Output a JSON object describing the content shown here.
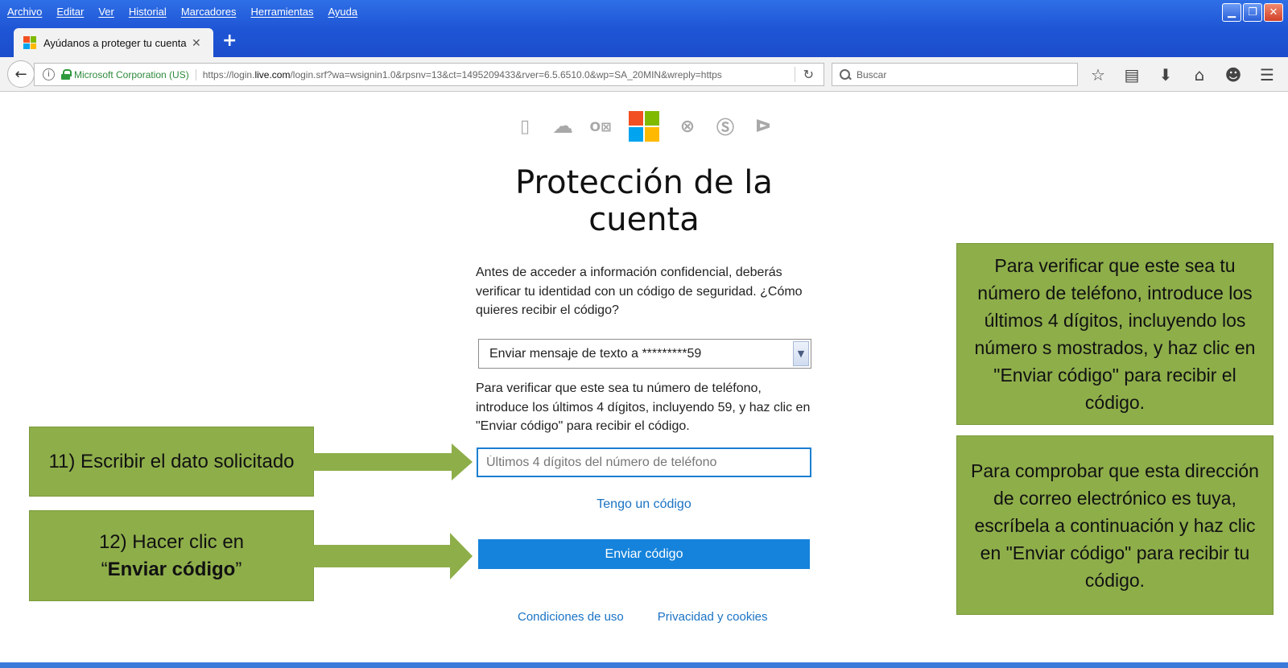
{
  "menubar": {
    "items": [
      "Archivo",
      "Editar",
      "Ver",
      "Historial",
      "Marcadores",
      "Herramientas",
      "Ayuda"
    ]
  },
  "tab": {
    "title": "Ayúdanos a proteger tu cuenta",
    "close": "✕"
  },
  "newtab": "+",
  "urlbar": {
    "identity": "Microsoft Corporation (US)",
    "url_prefix": "https://login.",
    "url_host": "live.com",
    "url_rest": "/login.srf?wa=wsignin1.0&rpsnv=13&ct=1495209433&rver=6.5.6510.0&wp=SA_20MIN&wreply=https"
  },
  "searchbar": {
    "placeholder": "Buscar"
  },
  "page": {
    "heading": "Protección de la cuenta",
    "intro": "Antes de acceder a información confidencial, deberás verificar tu identidad con un código de seguridad. ¿Cómo quieres recibir el código?",
    "select_value": "Enviar mensaje de texto a *********59",
    "verify_text": "Para verificar que este sea tu número de teléfono, introduce los últimos 4 dígitos, incluyendo 59, y haz clic en \"Enviar código\" para recibir el código.",
    "phone_placeholder": "Últimos 4 dígitos del número de teléfono",
    "have_code": "Tengo un código",
    "send_button": "Enviar código",
    "footer": {
      "terms": "Condiciones de uso",
      "privacy": "Privacidad y cookies"
    }
  },
  "annotations": {
    "step11": "11) Escribir el dato solicitado",
    "step12_line1": "12) Hacer clic en",
    "step12_quote_open": "“",
    "step12_bold": "Enviar código",
    "step12_quote_close": "”",
    "right_top": "Para verificar que este sea tu número de teléfono, introduce los últimos 4 dígitos, incluyendo los número s mostrados, y haz clic en \"Enviar código\" para recibir el código.",
    "right_bottom": "Para comprobar que esta dirección de correo electrónico es tuya, escríbela a continuación y haz clic en \"Enviar código\" para recibir tu código."
  },
  "colors": {
    "accent": "#1583db",
    "link": "#1a73c4",
    "callout_green": "#8eae4a",
    "titlebar_blue": "#1f56d6"
  },
  "icons": {
    "products": [
      "office-icon",
      "onedrive-icon",
      "outlook-icon",
      "microsoft-logo",
      "xbox-icon",
      "skype-icon",
      "bing-icon"
    ],
    "toolbar": [
      "bookmark-star-icon",
      "reading-list-icon",
      "download-icon",
      "home-icon",
      "chat-icon",
      "menu-icon"
    ]
  }
}
